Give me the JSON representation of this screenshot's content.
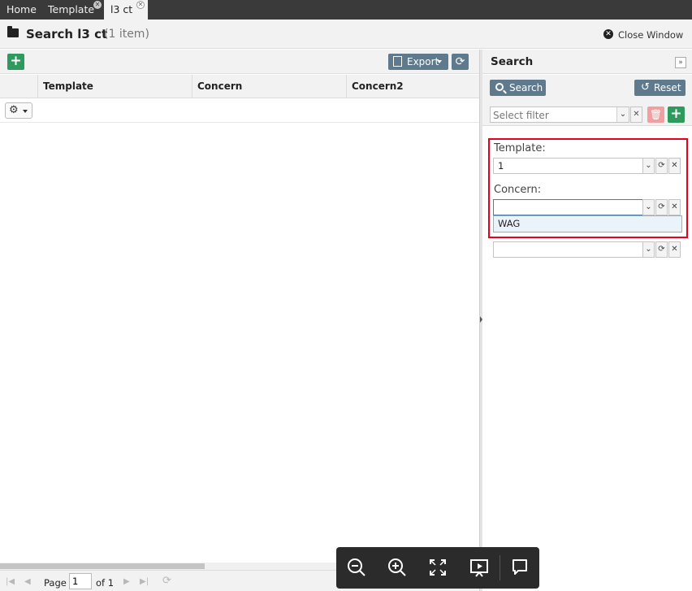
{
  "tabs": [
    {
      "label": "Home",
      "active": false,
      "closable": false
    },
    {
      "label": "Template",
      "active": false,
      "closable": true
    },
    {
      "label": "l3 ct",
      "active": true,
      "closable": true
    }
  ],
  "header": {
    "title": "Search l3 ct",
    "count": "(1 item)",
    "close_window": "Close Window"
  },
  "toolbar": {
    "add_icon": "plus-icon",
    "export_label": "Export",
    "refresh_icon": "refresh-icon"
  },
  "grid": {
    "columns": [
      "Template",
      "Concern",
      "Concern2"
    ],
    "row_action_icon": "gear-icon"
  },
  "pager": {
    "page_label": "Page",
    "page_value": "1",
    "of_label": "of 1"
  },
  "search_panel": {
    "title": "Search",
    "search_label": "Search",
    "reset_label": "Reset",
    "filter_placeholder": "Select filter",
    "fields": [
      {
        "label": "Template:",
        "value": "1"
      },
      {
        "label": "Concern:",
        "value": ""
      }
    ],
    "suggestion": "WAG"
  },
  "colors": {
    "accent_green": "#2e9a5e",
    "button_slate": "#5e7a8c",
    "highlight_red": "#e8001c",
    "tabbar": "#3a3a3a"
  },
  "viewer_toolbar": [
    "zoom-out-icon",
    "zoom-in-icon",
    "fit-screen-icon",
    "present-icon",
    "comment-icon"
  ]
}
